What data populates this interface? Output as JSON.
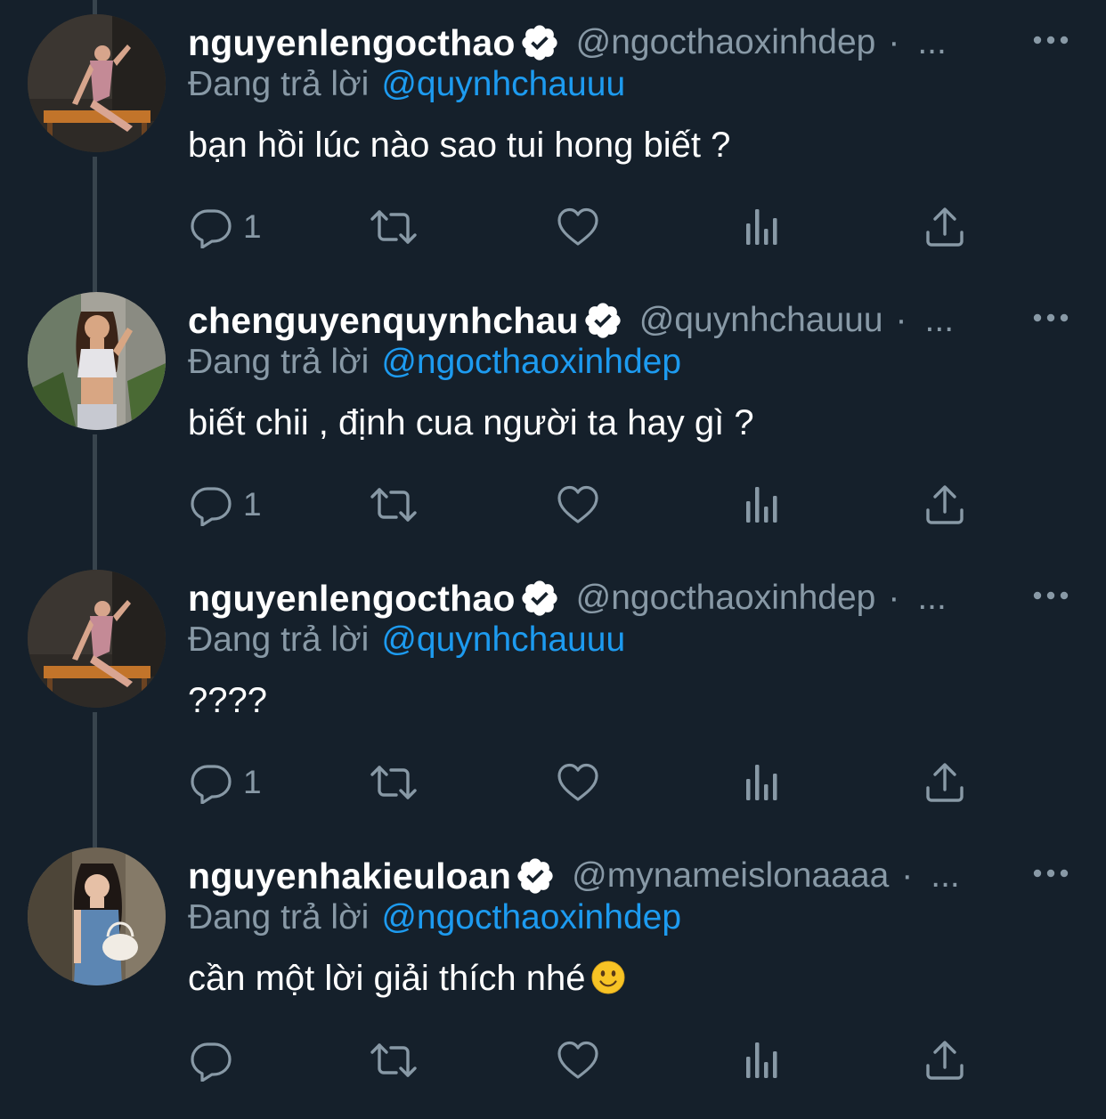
{
  "colors": {
    "background": "#15202b",
    "secondary_text": "#8899a6",
    "link": "#1d9bf0",
    "thread_line": "#38444d"
  },
  "icons": {
    "verified": "verified-badge-icon",
    "more": "more-horizontal-icon",
    "reply": "speech-bubble-icon",
    "retweet": "retweet-arrows-icon",
    "like": "heart-icon",
    "views": "bar-chart-icon",
    "share": "upload-arrow-icon"
  },
  "tweets": [
    {
      "display_name": "nguyenlengocthao",
      "handle": "@ngocthaoxinhdep",
      "separator": "·",
      "ellipsis": "...",
      "reply_prefix": "Đang trả lời",
      "reply_to": "@quynhchauuu",
      "text": "bạn hồi lúc nào sao tui hong biết ?",
      "reply_count": "1"
    },
    {
      "display_name": "chenguyenquynhchau",
      "handle": "@quynhchauuu",
      "separator": "·",
      "ellipsis": "...",
      "reply_prefix": "Đang trả lời",
      "reply_to": "@ngocthaoxinhdep",
      "text": "biết chii , định cua người ta hay gì ?",
      "reply_count": "1"
    },
    {
      "display_name": "nguyenlengocthao",
      "handle": "@ngocthaoxinhdep",
      "separator": "·",
      "ellipsis": "...",
      "reply_prefix": "Đang trả lời",
      "reply_to": "@quynhchauuu",
      "text": "????",
      "reply_count": "1"
    },
    {
      "display_name": "nguyenhakieuloan",
      "handle": "@mynameislonaaaa",
      "separator": "·",
      "ellipsis": "...",
      "reply_prefix": "Đang trả lời",
      "reply_to": "@ngocthaoxinhdep",
      "text": "cần một lời giải thích nhé",
      "emoji": "slightly-smiling-face",
      "reply_count": ""
    }
  ]
}
